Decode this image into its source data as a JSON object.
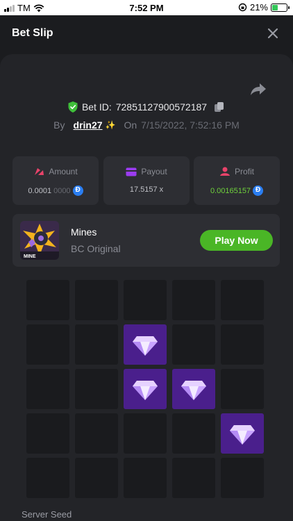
{
  "status_bar": {
    "carrier": "TM",
    "time": "7:52 PM",
    "battery": "21%"
  },
  "header": {
    "title": "Bet Slip"
  },
  "bet": {
    "id_label": "Bet ID:",
    "id_value": "72851127900572187",
    "by_label": "By",
    "username": "drin27",
    "sparkle": "✨",
    "on_label": "On",
    "datetime": "7/15/2022, 7:52:16 PM"
  },
  "stats": {
    "amount": {
      "label": "Amount",
      "value_main": "0.0001",
      "value_dim": "0000"
    },
    "payout": {
      "label": "Payout",
      "value": "17.5157 x"
    },
    "profit": {
      "label": "Profit",
      "value": "0.00165157"
    }
  },
  "game": {
    "name": "Mines",
    "subtitle": "BC Original",
    "thumb_text": "MINE",
    "play_label": "Play Now"
  },
  "grid": {
    "rows": 5,
    "cols": 5,
    "gems": [
      [
        1,
        2
      ],
      [
        2,
        2
      ],
      [
        2,
        3
      ],
      [
        3,
        4
      ]
    ]
  },
  "footer": {
    "server_seed_label": "Server Seed"
  },
  "colors": {
    "accent_green": "#4ab626",
    "gem_tile": "#4a1f8c",
    "profit_green": "#6fd13c",
    "coin_blue": "#2a7ef2"
  },
  "icons": {
    "close": "close-icon",
    "share": "share-icon",
    "verified": "shield-check-icon",
    "copy": "copy-icon",
    "amount": "chip-icon",
    "payout": "wallet-icon",
    "profit": "profit-icon",
    "currency": "dogecoin-icon",
    "tile_gem": "diamond-icon"
  }
}
